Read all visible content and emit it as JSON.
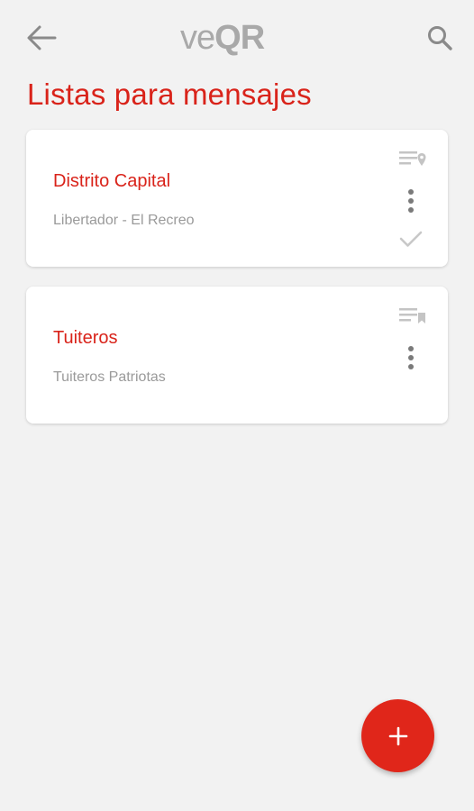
{
  "app_bar": {
    "back_icon": "arrow-left-icon",
    "logo_ve": "ve",
    "logo_qr": "QR",
    "search_icon": "search-icon"
  },
  "page": {
    "title": "Listas para mensajes"
  },
  "lists": [
    {
      "title": "Distrito Capital",
      "subtitle": "Libertador - El Recreo",
      "type_icon": "list-location-icon",
      "menu_icon": "more-vertical-icon",
      "status_icon": "check-icon"
    },
    {
      "title": "Tuiteros",
      "subtitle": "Tuiteros Patriotas",
      "type_icon": "list-bookmark-icon",
      "menu_icon": "more-vertical-icon"
    }
  ],
  "fab": {
    "icon": "plus-icon"
  },
  "colors": {
    "accent": "#d9231a",
    "fab": "#e0261a",
    "background": "#f2f2f2",
    "icon_gray": "#8a8a8a"
  }
}
